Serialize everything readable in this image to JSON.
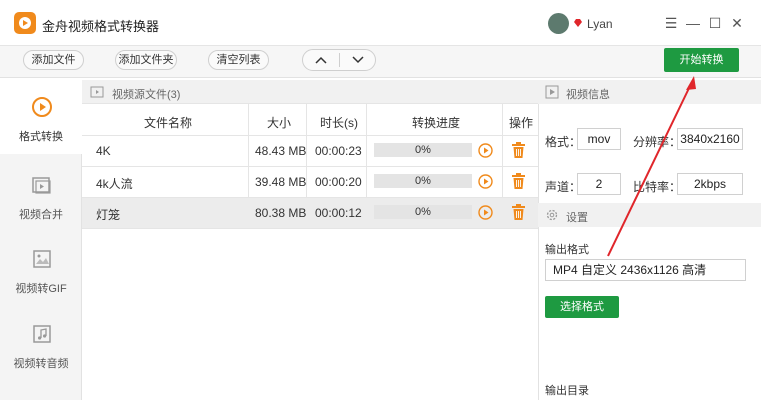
{
  "app": {
    "title": "金舟视频格式转换器",
    "user": "Lyan"
  },
  "window_controls": {
    "menu": "☰",
    "minimize": "—",
    "maximize": "☐",
    "close": "✕"
  },
  "toolbar": {
    "add_file": "添加文件",
    "add_folder": "添加文件夹",
    "clear_list": "清空列表",
    "up": "︿",
    "down": "﹀",
    "start": "开始转换"
  },
  "sidebar": {
    "items": [
      {
        "label": "格式转换",
        "icon": "play-circle-icon",
        "active": true
      },
      {
        "label": "视频合并",
        "icon": "merge-video-icon",
        "active": false
      },
      {
        "label": "视频转GIF",
        "icon": "gif-image-icon",
        "active": false
      },
      {
        "label": "视频转音频",
        "icon": "music-note-icon",
        "active": false
      }
    ]
  },
  "files": {
    "title": "视频源文件(3)",
    "columns": [
      "文件名称",
      "大小",
      "时长(s)",
      "转换进度",
      "操作"
    ],
    "rows": [
      {
        "name": "4K",
        "size": "48.43 MB",
        "duration": "00:00:23",
        "progress": "0%"
      },
      {
        "name": "4k人流",
        "size": "39.48 MB",
        "duration": "00:00:20",
        "progress": "0%"
      },
      {
        "name": "灯笼",
        "size": "80.38 MB",
        "duration": "00:00:12",
        "progress": "0%"
      }
    ]
  },
  "video_info": {
    "title": "视频信息",
    "format_label": "格式：",
    "format_value": "mov",
    "resolution_label": "分辨率：",
    "resolution_value": "3840x2160",
    "channel_label": "声道：",
    "channel_value": "2",
    "bitrate_label": "比特率：",
    "bitrate_value": "2kbps"
  },
  "settings": {
    "title": "设置",
    "output_format_label": "输出格式",
    "output_format_value": "MP4 自定义 2436x1126 高清",
    "select_format_button": "选择格式",
    "output_dir_label": "输出目录"
  },
  "colors": {
    "accent": "#1e9a41",
    "logo": "#f08a1c",
    "icon_orange": "#f08a1c",
    "annotation": "#e0262b"
  }
}
